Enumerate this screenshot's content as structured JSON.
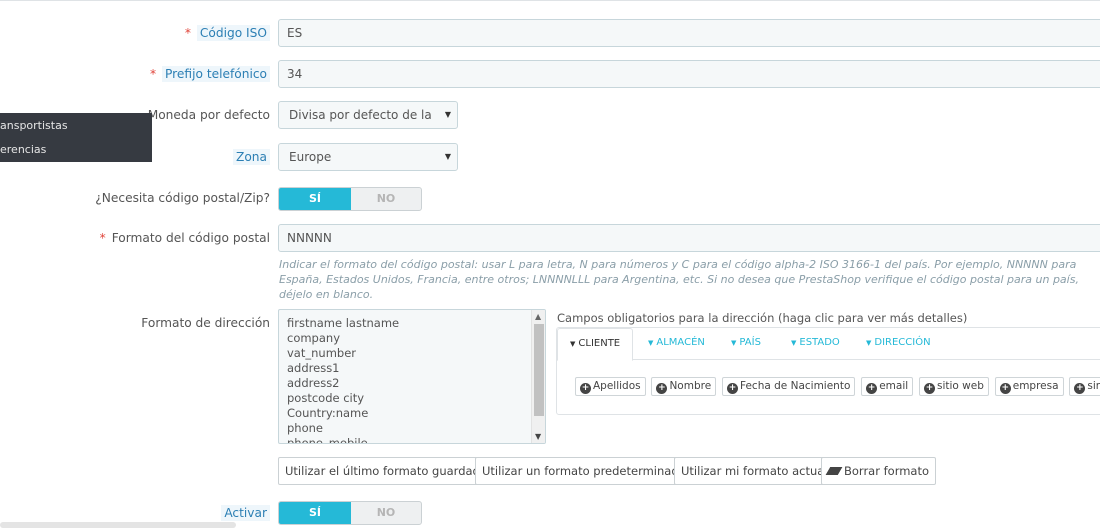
{
  "form": {
    "iso_code": {
      "label": "Código ISO",
      "value": "ES"
    },
    "phone_prefix": {
      "label": "Prefijo telefónico",
      "value": "34"
    },
    "default_currency": {
      "label": "Moneda por defecto",
      "value": "Divisa por defecto de la tienda"
    },
    "zone": {
      "label": "Zona",
      "value": "Europe"
    },
    "needs_zip": {
      "label": "¿Necesita código postal/Zip?",
      "on": "SÍ",
      "off": "NO"
    },
    "zip_format": {
      "label": "Formato del código postal",
      "value": "NNNNN",
      "help": "Indicar el formato del código postal: usar L para letra, N para números y C para el código alpha-2 ISO 3166-1 del país. Por ejemplo, NNNNN para España, Estados Unidos, Francia, entre otros; LNNNNLLL para Argentina, etc. Si no desea que PrestaShop verifique el código postal para un país, déjelo en blanco."
    },
    "address_format": {
      "label": "Formato de dirección",
      "lines": [
        "firstname lastname",
        "company",
        "vat_number",
        "address1",
        "address2",
        "postcode city",
        "Country:name",
        "phone",
        "phone_mobile"
      ]
    },
    "required_fields": {
      "title": "Campos obligatorios para la dirección (haga clic para ver más detalles)",
      "tabs": [
        "CLIENTE",
        "ALMACÉN",
        "PAÍS",
        "ESTADO",
        "DIRECCIÓN"
      ],
      "chips": [
        "Apellidos",
        "Nombre",
        "Fecha de Nacimiento",
        "email",
        "sitio web",
        "empresa",
        "siret"
      ]
    },
    "buttons": {
      "last_saved": "Utilizar el último formato guardado",
      "default_format": "Utilizar un formato predeterminado",
      "current_format": "Utilizar mi formato actual",
      "clear_format": "Borrar formato"
    },
    "activate": {
      "label": "Activar",
      "on": "SÍ",
      "off": "NO"
    }
  },
  "side_menu": {
    "items": [
      "ansportistas",
      "erencias"
    ]
  },
  "colors": {
    "accent": "#25b9d7",
    "required": "#e0443a",
    "menu_bg": "#363a41"
  }
}
